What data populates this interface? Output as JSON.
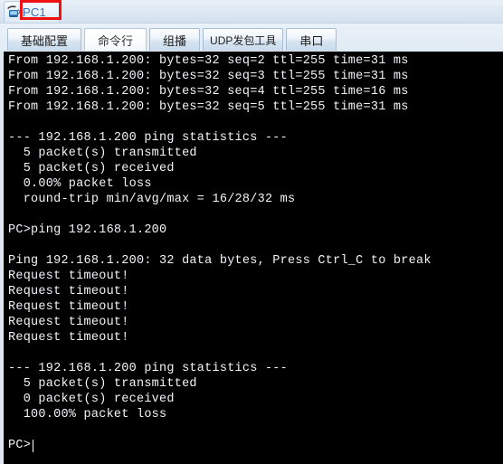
{
  "window": {
    "title": "PC1",
    "device_icon_name": "pc-device-icon",
    "highlight_color": "#ee1111"
  },
  "tabs": [
    {
      "label": "基础配置",
      "selected": false,
      "name": "tab-basic-config"
    },
    {
      "label": "命令行",
      "selected": true,
      "name": "tab-command-line"
    },
    {
      "label": "组播",
      "selected": false,
      "name": "tab-multicast"
    },
    {
      "label": "UDP发包工具",
      "selected": false,
      "name": "tab-udp-tool"
    },
    {
      "label": "串口",
      "selected": false,
      "name": "tab-serial-port"
    }
  ],
  "terminal": {
    "background_color": "#000000",
    "text_color": "#f2f4f8",
    "prompt": "PC>",
    "content": "From 192.168.1.200: bytes=32 seq=2 ttl=255 time=31 ms\nFrom 192.168.1.200: bytes=32 seq=3 ttl=255 time=31 ms\nFrom 192.168.1.200: bytes=32 seq=4 ttl=255 time=16 ms\nFrom 192.168.1.200: bytes=32 seq=5 ttl=255 time=31 ms\n\n--- 192.168.1.200 ping statistics ---\n  5 packet(s) transmitted\n  5 packet(s) received\n  0.00% packet loss\n  round-trip min/avg/max = 16/28/32 ms\n\nPC>ping 192.168.1.200\n\nPing 192.168.1.200: 32 data bytes, Press Ctrl_C to break\nRequest timeout!\nRequest timeout!\nRequest timeout!\nRequest timeout!\nRequest timeout!\n\n--- 192.168.1.200 ping statistics ---\n  5 packet(s) transmitted\n  0 packet(s) received\n  100.00% packet loss\n\nPC>"
  }
}
